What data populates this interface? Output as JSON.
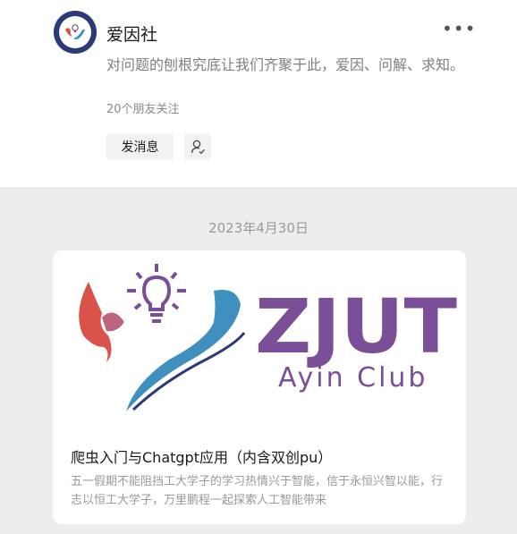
{
  "profile": {
    "name": "爱因社",
    "description": "对问题的刨根究底让我们齐聚于此，爱因、问解、求知。",
    "followers": "20个朋友关注",
    "message_label": "发消息",
    "more_icon": "more-icon",
    "user_icon": "user-check-icon"
  },
  "feed": {
    "date": "2023年4月30日",
    "article": {
      "cover": {
        "logo_title": "ZJUT",
        "logo_subtitle": "Ayin Club"
      },
      "title": "爬虫入门与Chatgpt应用（内含双创pu）",
      "summary": "五一假期不能阻挡工大学子的学习热情兴于智能，信于永恒兴智以能，行志以恒工大学子，万里鹏程一起探索人工智能带来"
    }
  },
  "colors": {
    "brand_purple": "#7a4f97",
    "accent_red": "#d9534a",
    "accent_blue": "#3f8fbf",
    "page_bg": "#ededed"
  }
}
